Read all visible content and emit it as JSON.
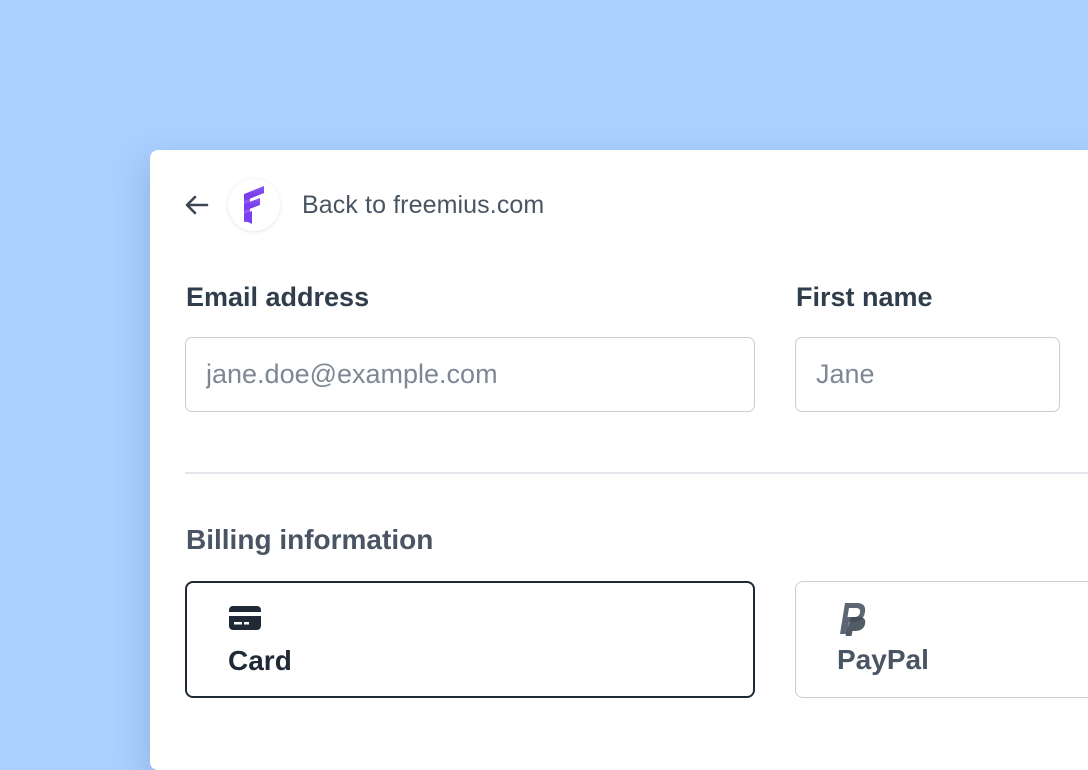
{
  "header": {
    "back_label": "Back to freemius.com",
    "logo_name": "freemius-logo",
    "back_icon": "arrow-left-icon"
  },
  "form": {
    "email": {
      "label": "Email address",
      "placeholder": "jane.doe@example.com",
      "value": ""
    },
    "first_name": {
      "label": "First name",
      "placeholder": "Jane",
      "value": ""
    }
  },
  "billing": {
    "title": "Billing information",
    "options": [
      {
        "label": "Card",
        "icon": "credit-card-icon",
        "selected": true
      },
      {
        "label": "PayPal",
        "icon": "paypal-icon",
        "selected": false
      }
    ]
  },
  "colors": {
    "background": "#aad0fe",
    "logo_purple": "#7b3ff2",
    "text_dark": "#1f2a36",
    "text_muted": "#4a5563"
  }
}
